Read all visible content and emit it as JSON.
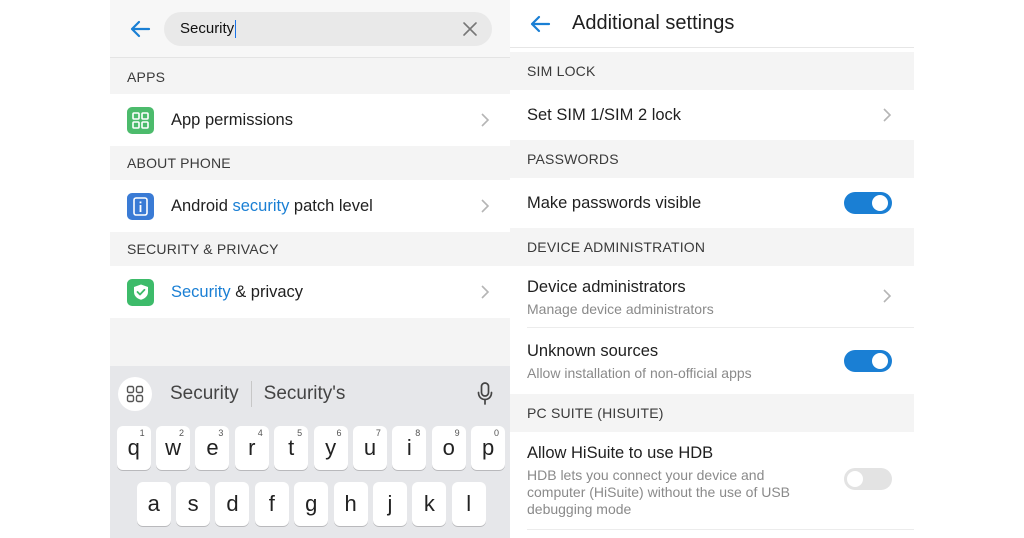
{
  "left": {
    "search": {
      "value": "Security"
    },
    "sections": {
      "apps": "APPS",
      "about": "ABOUT PHONE",
      "security": "SECURITY & PRIVACY"
    },
    "items": {
      "app_permissions": "App permissions",
      "patch_pre": "Android ",
      "patch_hl": "security",
      "patch_post": " patch level",
      "privacy_hl": "Security",
      "privacy_post": " & privacy"
    },
    "keyboard": {
      "suggestions": [
        "Security",
        "Security's"
      ],
      "row1": [
        {
          "k": "q",
          "s": "1"
        },
        {
          "k": "w",
          "s": "2"
        },
        {
          "k": "e",
          "s": "3"
        },
        {
          "k": "r",
          "s": "4"
        },
        {
          "k": "t",
          "s": "5"
        },
        {
          "k": "y",
          "s": "6"
        },
        {
          "k": "u",
          "s": "7"
        },
        {
          "k": "i",
          "s": "8"
        },
        {
          "k": "o",
          "s": "9"
        },
        {
          "k": "p",
          "s": "0"
        }
      ],
      "row2": [
        "a",
        "s",
        "d",
        "f",
        "g",
        "h",
        "j",
        "k",
        "l"
      ]
    }
  },
  "right": {
    "title": "Additional settings",
    "sections": {
      "sim": "SIM LOCK",
      "passwords": "PASSWORDS",
      "device_admin": "DEVICE ADMINISTRATION",
      "pc_suite": "PC SUITE (HISUITE)"
    },
    "rows": {
      "sim_lock": "Set SIM 1/SIM 2 lock",
      "passwords_visible": "Make passwords visible",
      "device_admins": "Device administrators",
      "device_admins_sub": "Manage device administrators",
      "unknown_sources": "Unknown sources",
      "unknown_sources_sub": "Allow installation of non-official apps",
      "hisuite": "Allow HiSuite to use HDB",
      "hisuite_sub": "HDB lets you connect your device and computer (HiSuite) without the use of USB debugging mode"
    },
    "toggles": {
      "passwords_visible": true,
      "unknown_sources": true,
      "hisuite": false
    }
  },
  "colors": {
    "accent": "#1a7fd4",
    "app_permissions_icon": "#4cbb6c",
    "patch_icon": "#3a7bd5",
    "privacy_icon": "#3dbb6a"
  },
  "icons": {
    "back": "arrow-left-icon",
    "clear": "close-icon",
    "app_permissions": "apps-grid-icon",
    "patch": "info-icon",
    "privacy": "shield-check-icon",
    "chevron": "chevron-right-icon",
    "keyboard_menu": "grid-icon",
    "mic": "microphone-icon"
  }
}
